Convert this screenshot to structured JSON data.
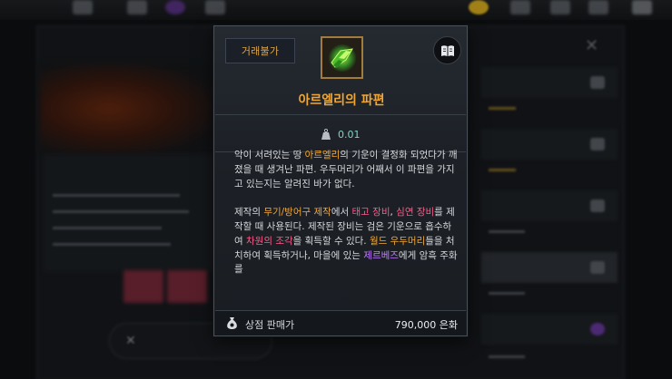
{
  "tooltip": {
    "trade_badge": "거래불가",
    "item_name": "아르엘리의 파편",
    "weight": "0.01",
    "description": {
      "para1": [
        {
          "text": "악이 서려있는 땅 ",
          "style": "normal"
        },
        {
          "text": "아르엘리",
          "style": "gold"
        },
        {
          "text": "의 기운이 결정화 되었다가 깨졌을 때 생겨난 파편. 우두머리가 어째서 이 파편을 가지고 있는지는 알려진 바가 없다.",
          "style": "normal"
        }
      ],
      "para2": [
        {
          "text": "제작의 ",
          "style": "normal"
        },
        {
          "text": "무기/방어구 제작",
          "style": "gold"
        },
        {
          "text": "에서 ",
          "style": "normal"
        },
        {
          "text": "태고 장비",
          "style": "pink"
        },
        {
          "text": ", ",
          "style": "normal"
        },
        {
          "text": "심연 장비",
          "style": "pink"
        },
        {
          "text": "를 제작할 때 사용된다. 제작된 장비는 검은 기운으로 흡수하여 ",
          "style": "normal"
        },
        {
          "text": "차원의 조각",
          "style": "pink"
        },
        {
          "text": "을 획득할 수 있다. ",
          "style": "normal"
        },
        {
          "text": "월드 우두머리",
          "style": "gold"
        },
        {
          "text": "들을 처치하여 획득하거나, 마을에 있는 ",
          "style": "normal"
        },
        {
          "text": "제르베즈",
          "style": "purple"
        },
        {
          "text": "에게 암흑 주화를",
          "style": "normal"
        }
      ]
    },
    "price_label": "상점 판매가",
    "price_value": "790,000 은화"
  },
  "icons": {
    "item": "arelli-shard-icon",
    "book": "book-icon",
    "weight": "weight-icon",
    "price": "money-bag-icon"
  },
  "colors": {
    "accent_gold": "#f0a737",
    "highlight_pink": "#ff5a8a",
    "highlight_purple": "#c07cff",
    "weight_teal": "#7fd4c4"
  }
}
